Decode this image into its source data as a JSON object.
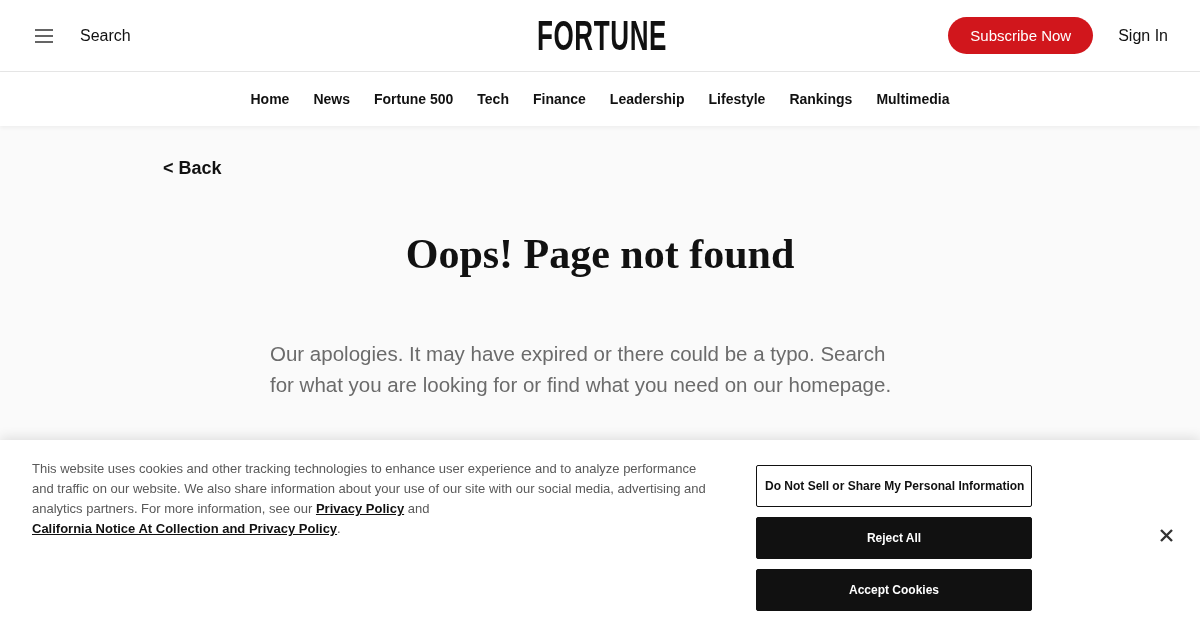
{
  "header": {
    "search_label": "Search",
    "logo": "FORTUNE",
    "subscribe_button": "Subscribe Now",
    "sign_in": "Sign In"
  },
  "nav": [
    "Home",
    "News",
    "Fortune 500",
    "Tech",
    "Finance",
    "Leadership",
    "Lifestyle",
    "Rankings",
    "Multimedia"
  ],
  "back_link": "< Back",
  "heading": "Oops! Page not found",
  "message": "Our apologies. It may have expired or there could be a typo. Search for what you are looking for or find what you need on our homepage.",
  "cookie_banner": {
    "notice": [
      {
        "kind": "text",
        "text": "This website uses cookies and other tracking technologies to enhance user experience and to analyze performance and traffic on our website. We also share information about your use of our site with our social media, advertising and analytics partners. For more information, see our "
      },
      {
        "kind": "link",
        "text": "Privacy Policy"
      },
      {
        "kind": "text",
        "text": " and "
      },
      {
        "kind": "link",
        "text": "California Notice At Collection and Privacy Policy"
      },
      {
        "kind": "text",
        "text": "."
      }
    ],
    "buttons": [
      {
        "kind": "outline",
        "label": "Do Not Sell or Share My Personal Information"
      },
      {
        "kind": "filled",
        "label": "Reject All"
      },
      {
        "kind": "filled",
        "label": "Accept Cookies"
      }
    ]
  }
}
